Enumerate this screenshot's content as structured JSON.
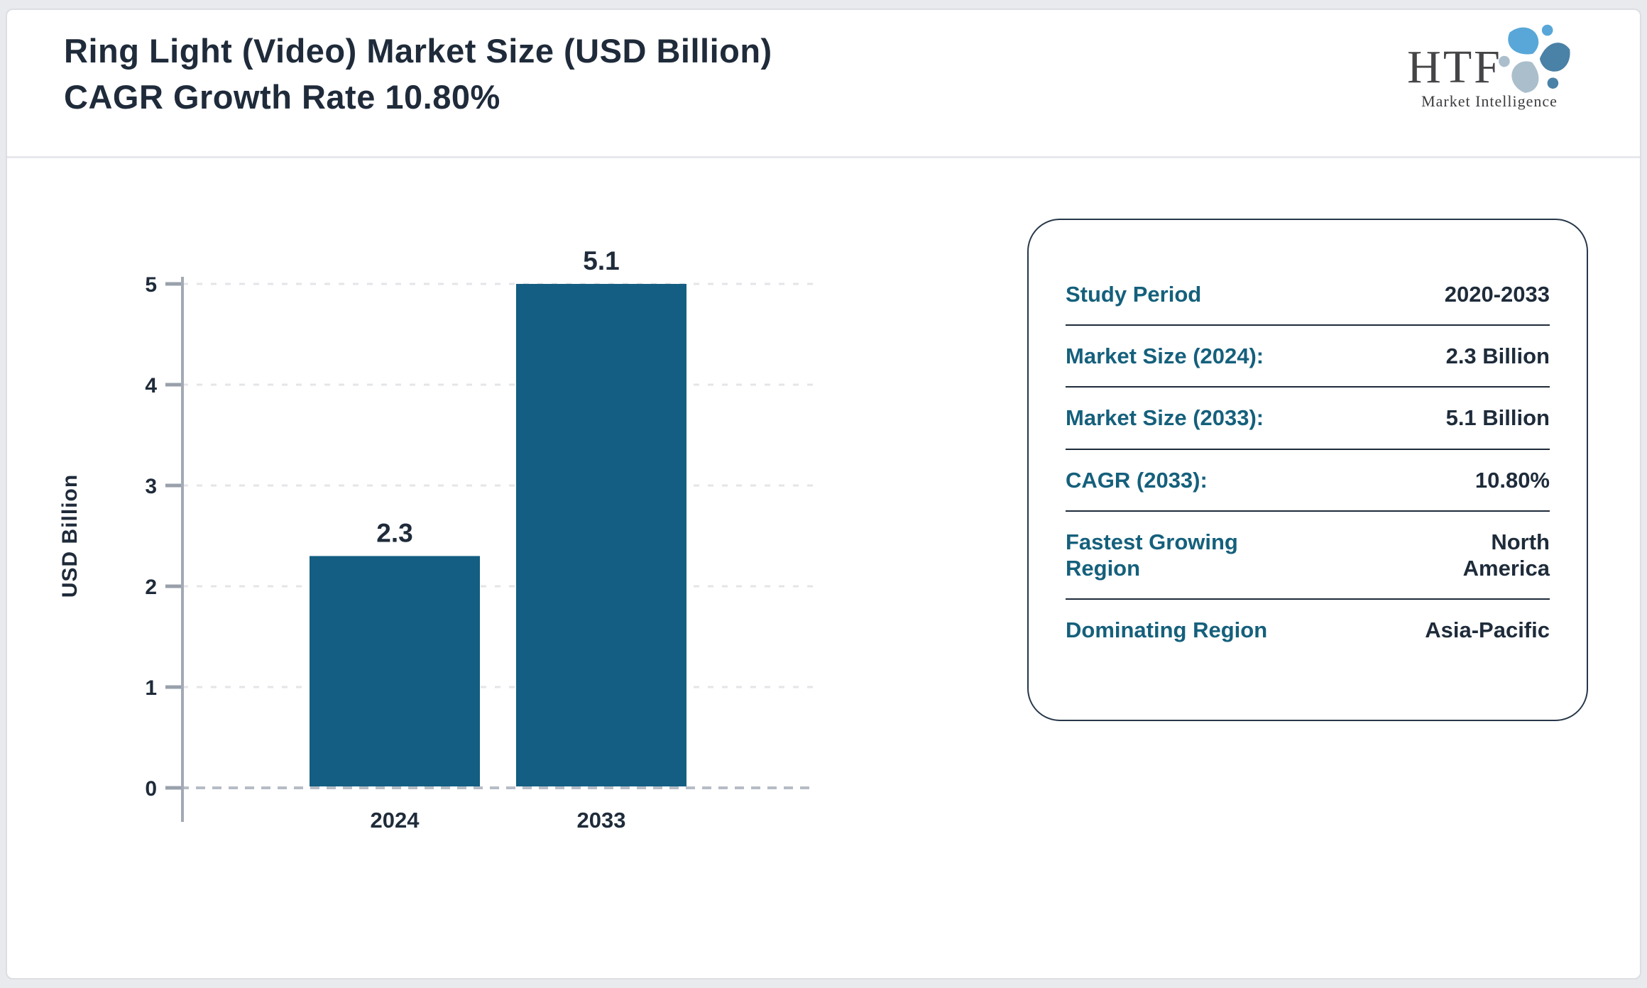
{
  "header": {
    "title_line1": "Ring Light (Video) Market Size (USD Billion)",
    "title_line2": "CAGR Growth Rate 10.80%"
  },
  "logo": {
    "brand": "HTF",
    "tagline": "Market Intelligence",
    "icon": "htf-triskelion-icon",
    "icon_colors": [
      "#58a7d8",
      "#4a81a6",
      "#abbecb"
    ]
  },
  "chart_data": {
    "type": "bar",
    "title": "",
    "categories": [
      "2024",
      "2033"
    ],
    "values": [
      2.3,
      5.1
    ],
    "bar_labels": [
      "2.3",
      "5.1"
    ],
    "xlabel": "",
    "ylabel": "USD Billion",
    "ylim": [
      0,
      5
    ],
    "yticks": [
      0,
      1,
      2,
      3,
      4,
      5
    ],
    "grid": true,
    "grid_style": "dashed",
    "legend": "none",
    "bar_color": "#135e82"
  },
  "info_card": {
    "rows": [
      {
        "label": "Study Period",
        "value": "2020-2033"
      },
      {
        "label": "Market Size (2024):",
        "value": "2.3 Billion"
      },
      {
        "label": "Market Size (2033):",
        "value": "5.1 Billion"
      },
      {
        "label": "CAGR (2033):",
        "value": "10.80%"
      },
      {
        "label": "Fastest Growing Region",
        "value": "North America"
      },
      {
        "label": "Dominating Region",
        "value": "Asia-Pacific"
      }
    ]
  },
  "colors": {
    "accent_teal": "#15607c",
    "dark_navy": "#1f2b3a",
    "bar_fill": "#135e82",
    "grid_line": "#e4e5e8",
    "axis_gray": "#a3a9b5",
    "page_background": "#e9eaee",
    "card_border": "#27374a"
  }
}
